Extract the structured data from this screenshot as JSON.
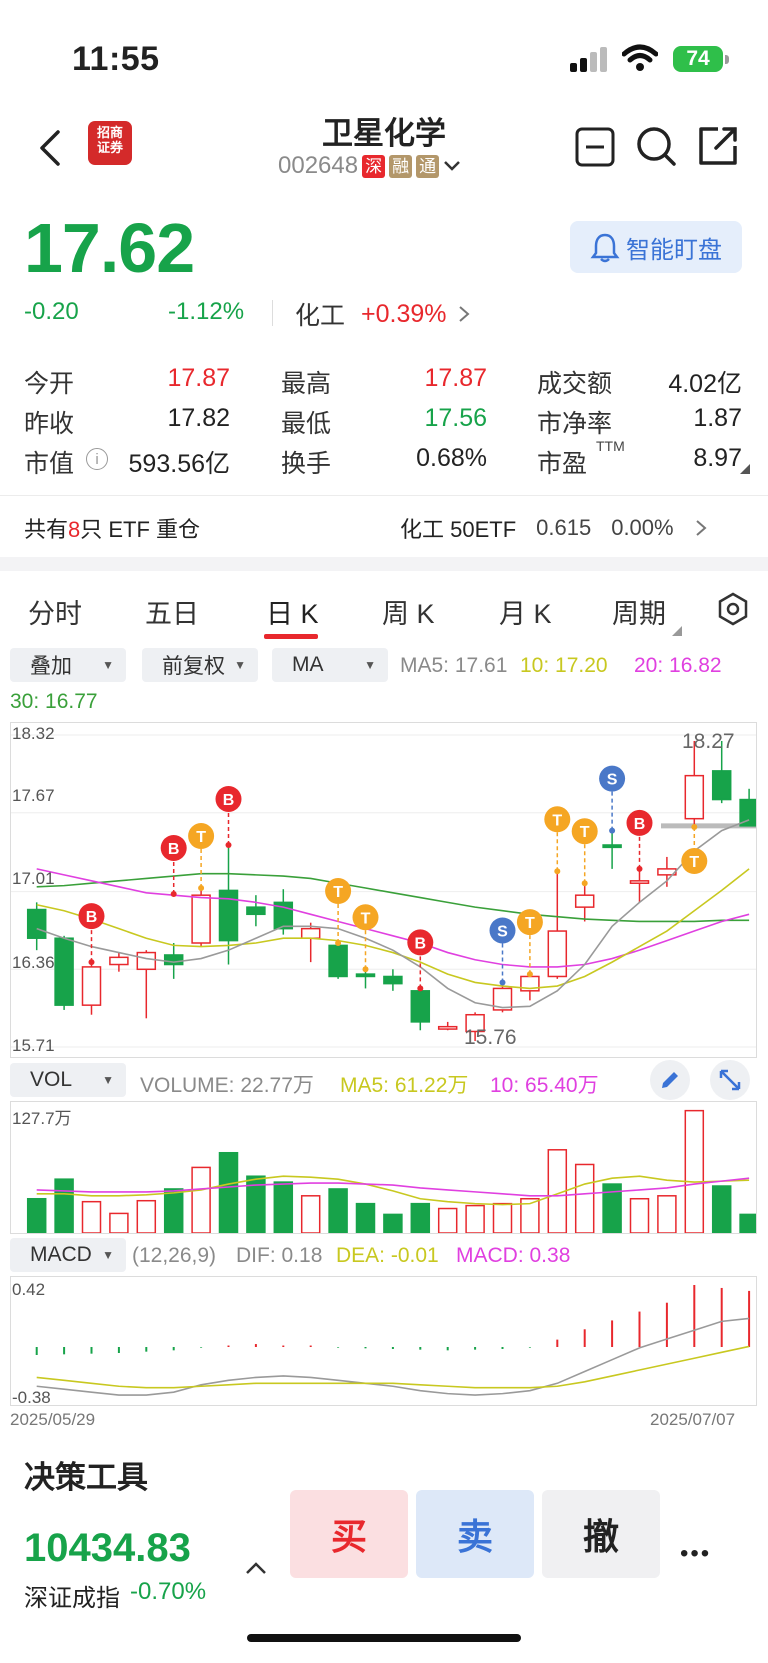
{
  "status_bar": {
    "time": "11:55",
    "battery": "74"
  },
  "header": {
    "broker_logo_text": "招商\n证券",
    "stock_name": "卫星化学",
    "stock_code": "002648",
    "badges": [
      "深",
      "融",
      "通"
    ]
  },
  "quote": {
    "price": "17.62",
    "change": "-0.20",
    "change_pct": "-1.12%",
    "sector": "化工",
    "sector_change": "+0.39%",
    "smart_watch_label": "智能盯盘"
  },
  "stats": [
    [
      {
        "label": "今开",
        "value": "17.87",
        "color": "red"
      },
      {
        "label": "最高",
        "value": "17.87",
        "color": "red"
      },
      {
        "label": "成交额",
        "value": "4.02亿",
        "color": "dark"
      }
    ],
    [
      {
        "label": "昨收",
        "value": "17.82",
        "color": "dark"
      },
      {
        "label": "最低",
        "value": "17.56",
        "color": "green"
      },
      {
        "label": "市净率",
        "value": "1.87",
        "color": "dark"
      }
    ],
    [
      {
        "label": "市值",
        "value": "593.56亿",
        "color": "dark"
      },
      {
        "label": "换手",
        "value": "0.68%",
        "color": "dark"
      },
      {
        "label": "市盈",
        "value": "8.97",
        "color": "dark"
      }
    ]
  ],
  "pe_superscript": "TTM",
  "etf": {
    "prefix": "共有",
    "count": "8",
    "suffix": "只 ETF 重仓",
    "name": "化工 50ETF",
    "price": "0.615",
    "pct": "0.00%"
  },
  "tabs": [
    "分时",
    "五日",
    "日 K",
    "周 K",
    "月 K",
    "周期"
  ],
  "active_tab": "日 K",
  "overlay_controls": {
    "overlay": "叠加",
    "adjust": "前复权",
    "indicator": "MA"
  },
  "ma_info": {
    "ma5": "MA5: 17.61",
    "ma10": "10: 17.20",
    "ma20": "20: 16.82",
    "ma30": "30: 16.77"
  },
  "colors": {
    "up": "#e8282d",
    "down": "#17a34a",
    "ma5": "#9a9a9a",
    "ma10": "#c8c820",
    "ma20": "#e040e0",
    "ma30": "#3aa03a",
    "buy_marker": "#e8282d",
    "t_marker": "#f5a623",
    "s_marker": "#4a78c8"
  },
  "kline_axis": {
    "top": "18.32",
    "l2": "17.67",
    "l3": "17.01",
    "l4": "16.36",
    "bottom": "15.71",
    "high_label": "18.27",
    "low_label": "15.76"
  },
  "vol_info": {
    "selector": "VOL",
    "volume": "VOLUME: 22.77万",
    "ma5": "MA5: 61.22万",
    "ma10": "10: 65.40万",
    "top_label": "127.7万"
  },
  "macd_info": {
    "selector": "MACD",
    "params": "(12,26,9)",
    "dif": "DIF: 0.18",
    "dea": "DEA: -0.01",
    "macd": "MACD: 0.38",
    "top": "0.42",
    "bottom": "-0.38",
    "start_date": "2025/05/29",
    "end_date": "2025/07/07"
  },
  "section_title": "决策工具",
  "bottom": {
    "index_value": "10434.83",
    "index_name": "深证成指",
    "index_pct": "-0.70%",
    "buy": "买",
    "sell": "卖",
    "cancel": "撤",
    "more": "•••"
  },
  "chart_data": {
    "type": "candlestick",
    "title": "",
    "y_range": [
      15.71,
      18.32
    ],
    "candles": [
      {
        "o": 16.86,
        "c": 16.62,
        "h": 16.92,
        "l": 16.52
      },
      {
        "o": 16.62,
        "c": 16.06,
        "h": 16.64,
        "l": 16.02
      },
      {
        "o": 16.06,
        "c": 16.38,
        "h": 16.42,
        "l": 15.98
      },
      {
        "o": 16.4,
        "c": 16.46,
        "h": 16.5,
        "l": 16.34
      },
      {
        "o": 16.36,
        "c": 16.5,
        "h": 16.52,
        "l": 15.95
      },
      {
        "o": 16.48,
        "c": 16.4,
        "h": 16.58,
        "l": 16.28
      },
      {
        "o": 16.58,
        "c": 16.98,
        "h": 17.05,
        "l": 16.55
      },
      {
        "o": 17.02,
        "c": 16.6,
        "h": 17.4,
        "l": 16.4
      },
      {
        "o": 16.88,
        "c": 16.82,
        "h": 16.98,
        "l": 16.72
      },
      {
        "o": 16.92,
        "c": 16.7,
        "h": 17.03,
        "l": 16.65
      },
      {
        "o": 16.62,
        "c": 16.7,
        "h": 16.75,
        "l": 16.42
      },
      {
        "o": 16.56,
        "c": 16.3,
        "h": 16.58,
        "l": 16.28
      },
      {
        "o": 16.32,
        "c": 16.3,
        "h": 16.36,
        "l": 16.2
      },
      {
        "o": 16.3,
        "c": 16.24,
        "h": 16.36,
        "l": 16.18
      },
      {
        "o": 16.18,
        "c": 15.92,
        "h": 16.2,
        "l": 15.85
      },
      {
        "o": 15.86,
        "c": 15.88,
        "h": 15.92,
        "l": 15.85
      },
      {
        "o": 15.84,
        "c": 15.98,
        "h": 16.0,
        "l": 15.76
      },
      {
        "o": 16.02,
        "c": 16.2,
        "h": 16.25,
        "l": 16.0
      },
      {
        "o": 16.18,
        "c": 16.3,
        "h": 16.32,
        "l": 16.1
      },
      {
        "o": 16.3,
        "c": 16.68,
        "h": 17.2,
        "l": 16.28
      },
      {
        "o": 16.88,
        "c": 16.98,
        "h": 17.08,
        "l": 16.76
      },
      {
        "o": 17.4,
        "c": 17.38,
        "h": 17.5,
        "l": 17.2
      },
      {
        "o": 17.08,
        "c": 17.1,
        "h": 17.2,
        "l": 16.92
      },
      {
        "o": 17.15,
        "c": 17.2,
        "h": 17.3,
        "l": 17.05
      },
      {
        "o": 17.62,
        "c": 17.98,
        "h": 18.27,
        "l": 17.55
      },
      {
        "o": 18.02,
        "c": 17.78,
        "h": 18.27,
        "l": 17.75
      },
      {
        "o": 17.78,
        "c": 17.56,
        "h": 17.87,
        "l": 17.56
      }
    ],
    "ma5": [
      16.7,
      16.62,
      16.55,
      16.5,
      16.45,
      16.42,
      16.45,
      16.52,
      16.62,
      16.72,
      16.72,
      16.7,
      16.62,
      16.52,
      16.38,
      16.2,
      16.08,
      16.04,
      16.05,
      16.18,
      16.4,
      16.72,
      16.92,
      17.1,
      17.35,
      17.52,
      17.61
    ],
    "ma10": [
      16.9,
      16.85,
      16.78,
      16.7,
      16.62,
      16.56,
      16.55,
      16.56,
      16.58,
      16.62,
      16.62,
      16.6,
      16.56,
      16.5,
      16.42,
      16.32,
      16.25,
      16.22,
      16.2,
      16.22,
      16.3,
      16.42,
      16.55,
      16.68,
      16.85,
      17.02,
      17.2
    ],
    "ma20": [
      17.2,
      17.15,
      17.1,
      17.05,
      17.0,
      16.98,
      16.96,
      16.95,
      16.92,
      16.88,
      16.82,
      16.76,
      16.7,
      16.64,
      16.58,
      16.5,
      16.44,
      16.4,
      16.38,
      16.38,
      16.4,
      16.45,
      16.52,
      16.6,
      16.68,
      16.76,
      16.82
    ],
    "ma30": [
      17.05,
      17.06,
      17.08,
      17.1,
      17.12,
      17.14,
      17.16,
      17.16,
      17.15,
      17.14,
      17.12,
      17.08,
      17.04,
      17.0,
      16.96,
      16.92,
      16.88,
      16.85,
      16.82,
      16.8,
      16.78,
      16.77,
      16.76,
      16.76,
      16.76,
      16.77,
      16.77
    ],
    "markers": [
      {
        "i": 2,
        "t": "B",
        "price": 16.42
      },
      {
        "i": 5,
        "t": "B",
        "price": 16.99
      },
      {
        "i": 6,
        "t": "T",
        "price": 17.04
      },
      {
        "i": 7,
        "t": "B",
        "price": 17.4
      },
      {
        "i": 11,
        "t": "T",
        "price": 16.58
      },
      {
        "i": 12,
        "t": "T",
        "price": 16.36
      },
      {
        "i": 14,
        "t": "B",
        "price": 16.2
      },
      {
        "i": 17,
        "t": "S",
        "price": 16.25
      },
      {
        "i": 18,
        "t": "T",
        "price": 16.32
      },
      {
        "i": 19,
        "t": "T",
        "price": 17.18
      },
      {
        "i": 20,
        "t": "T",
        "price": 17.08
      },
      {
        "i": 21,
        "t": "S",
        "price": 17.52
      },
      {
        "i": 22,
        "t": "B",
        "price": 17.2
      },
      {
        "i": 24,
        "t": "T",
        "price": 17.55
      }
    ],
    "volume": [
      35,
      55,
      32,
      20,
      33,
      45,
      67,
      82,
      58,
      52,
      38,
      45,
      30,
      19,
      30,
      25,
      28,
      30,
      35,
      85,
      70,
      50,
      35,
      38,
      125,
      48,
      19
    ],
    "macd": [
      -0.12,
      -0.11,
      -0.1,
      -0.09,
      -0.07,
      -0.05,
      -0.01,
      0.01,
      0.02,
      0.01,
      0.01,
      -0.01,
      -0.02,
      -0.03,
      -0.04,
      -0.05,
      -0.04,
      -0.03,
      -0.01,
      0.05,
      0.12,
      0.18,
      0.24,
      0.3,
      0.42,
      0.4,
      0.38
    ],
    "dif": [
      -0.28,
      -0.3,
      -0.32,
      -0.34,
      -0.34,
      -0.32,
      -0.27,
      -0.24,
      -0.22,
      -0.21,
      -0.22,
      -0.24,
      -0.26,
      -0.28,
      -0.31,
      -0.33,
      -0.34,
      -0.33,
      -0.31,
      -0.26,
      -0.18,
      -0.1,
      -0.02,
      0.04,
      0.1,
      0.16,
      0.18
    ],
    "dea": [
      -0.22,
      -0.24,
      -0.26,
      -0.28,
      -0.29,
      -0.29,
      -0.28,
      -0.27,
      -0.26,
      -0.26,
      -0.26,
      -0.26,
      -0.26,
      -0.26,
      -0.27,
      -0.28,
      -0.29,
      -0.29,
      -0.29,
      -0.28,
      -0.25,
      -0.21,
      -0.17,
      -0.13,
      -0.09,
      -0.05,
      -0.01
    ],
    "vol_ma5": [
      40,
      40,
      38,
      38,
      39,
      41,
      44,
      50,
      55,
      58,
      57,
      55,
      50,
      43,
      35,
      32,
      30,
      29,
      30,
      40,
      50,
      56,
      58,
      54,
      52,
      53,
      54
    ],
    "vol_ma10": [
      44,
      43,
      42,
      42,
      42,
      43,
      45,
      47,
      49,
      50,
      51,
      51,
      50,
      49,
      46,
      44,
      42,
      40,
      38,
      38,
      40,
      42,
      44,
      46,
      50,
      53,
      56
    ]
  }
}
